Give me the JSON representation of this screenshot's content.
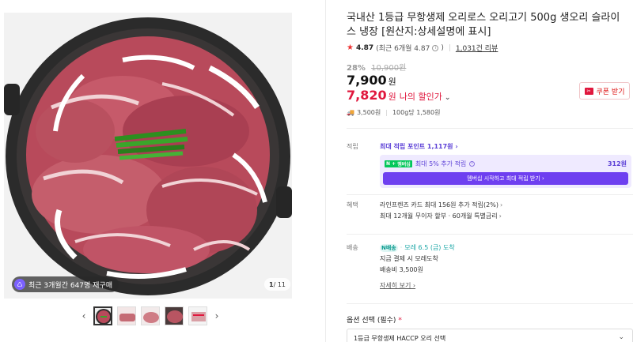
{
  "gallery": {
    "buy_badge": "최근 3개월간 647명 재구매",
    "counter_current": "1",
    "counter_total": "/ 11",
    "prev_label": "‹",
    "next_label": "›"
  },
  "product": {
    "title": "국내산 1등급 무항생제 오리로스 오리고기 500g 생오리 슬라이스 냉장 [원산지:상세설명에 표시]",
    "rating": "4.87",
    "rating_recent": "(최근 6개월 4.87",
    "rating_recent_end": ")",
    "reviews": "1,031건 리뷰",
    "discount_pct": "28%",
    "original_price": "10,900원",
    "price": "7,900",
    "price_unit": "원",
    "my_price": "7,820",
    "my_price_unit": "원",
    "my_price_label": "나의 할인가",
    "coupon_label": "쿠폰 받기",
    "ship_fee_mini": "3,500원",
    "unit_price": "100g당 1,580원"
  },
  "points": {
    "label": "적립",
    "max_points": "최대 적립 포인트 1,117원 ›",
    "npay": "N",
    "npay_plus": "멤버십",
    "extra": "최대 5% 추가 적립",
    "extra_amount": "312원",
    "membership_button": "멤버십 시작하고 최대 적립 받기 ›"
  },
  "benefits": {
    "label": "혜택",
    "card": "라인프렌즈 카드 최대 156원 추가 적립(2%)",
    "installment": "최대 12개월 무이자 할부 · 60개월 특별금리"
  },
  "delivery": {
    "label": "배송",
    "tag": "N배송",
    "arrival": "모레 6.5 (금) 도착",
    "note": "지금 결제 시 모레도착",
    "fee": "배송비 3,500원",
    "more": "자세히 보기 ›"
  },
  "option": {
    "label": "옵션 선택 (필수)",
    "required_mark": "*",
    "selected": "1등급 무항생제 HACCP 오리 선택"
  },
  "colors": {
    "accent_red": "#e0173d",
    "membership_purple": "#6e3ff0"
  }
}
